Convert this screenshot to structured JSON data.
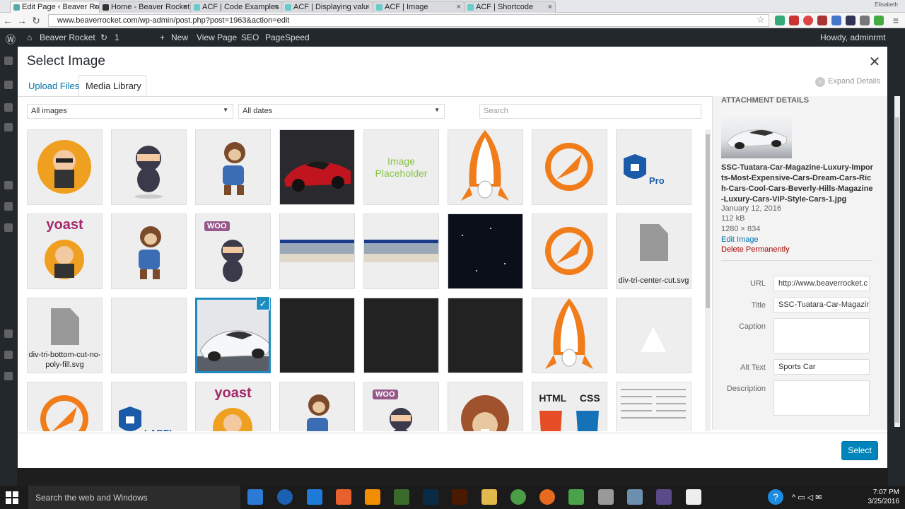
{
  "browser": {
    "tabs": [
      {
        "label": "Edit Page ‹ Beaver Ro",
        "active": true
      },
      {
        "label": "Home - Beaver Rocket"
      },
      {
        "label": "ACF | Code Examples"
      },
      {
        "label": "ACF | Displaying valu"
      },
      {
        "label": "ACF | Image"
      },
      {
        "label": "ACF | Shortcode"
      }
    ],
    "url": "www.beaverrocket.com/wp-admin/post.php?post=1963&action=edit",
    "user_badge": "Elisabeth"
  },
  "adminbar": {
    "site": "Beaver Rocket",
    "updates": "1",
    "new": "New",
    "view_page": "View Page",
    "seo": "SEO",
    "pagespeed": "PageSpeed",
    "howdy": "Howdy, adminrmt"
  },
  "modal": {
    "title": "Select Image",
    "tab_upload": "Upload Files",
    "tab_library": "Media Library",
    "expand_details": "Expand Details",
    "filter_type": "All images",
    "filter_date": "All dates",
    "search_placeholder": "Search",
    "select_button": "Select"
  },
  "grid": {
    "items": [
      {
        "kind": "avatar"
      },
      {
        "kind": "ninja"
      },
      {
        "kind": "monkey"
      },
      {
        "kind": "redcar"
      },
      {
        "kind": "placeholder",
        "label": "Image Placeholder"
      },
      {
        "kind": "rocket"
      },
      {
        "kind": "rocketlogo"
      },
      {
        "kind": "shield",
        "label": "Pro"
      },
      {
        "kind": "yoast",
        "label": "yoast"
      },
      {
        "kind": "monkey"
      },
      {
        "kind": "woo",
        "label": "WOO"
      },
      {
        "kind": "banner"
      },
      {
        "kind": "banner"
      },
      {
        "kind": "space"
      },
      {
        "kind": "rocketlogo"
      },
      {
        "kind": "file",
        "label": "div-tri-center-cut.svg"
      },
      {
        "kind": "file",
        "label": "div-tri-bottom-cut-no-poly-fill.svg"
      },
      {
        "kind": "blank"
      },
      {
        "kind": "whitecar",
        "selected": true
      },
      {
        "kind": "dark"
      },
      {
        "kind": "dark"
      },
      {
        "kind": "dark"
      },
      {
        "kind": "rocket"
      },
      {
        "kind": "triangle"
      },
      {
        "kind": "rocketlogo"
      },
      {
        "kind": "shield"
      },
      {
        "kind": "yoast",
        "label": "yoast"
      },
      {
        "kind": "monkey"
      },
      {
        "kind": "woo",
        "label": "WOO"
      },
      {
        "kind": "beaver"
      },
      {
        "kind": "htmlcss",
        "label": "HTML CSS"
      },
      {
        "kind": "newspaper"
      }
    ]
  },
  "details": {
    "heading": "Attachment Details",
    "filename": "SSC-Tuatara-Car-Magazine-Luxury-Imports-Most-Expensive-Cars-Dream-Cars-Rich-Cars-Cool-Cars-Beverly-Hills-Magazine-Luxury-Cars-VIP-Style-Cars-1.jpg",
    "date": "January 12, 2016",
    "size": "112 kB",
    "dimensions": "1280 × 834",
    "edit_image": "Edit Image",
    "delete": "Delete Permanently",
    "url_label": "URL",
    "url_value": "http://www.beaverrocket.c",
    "title_label": "Title",
    "title_value": "SSC-Tuatara-Car-Magazine",
    "caption_label": "Caption",
    "alt_label": "Alt Text",
    "alt_value": "Sports Car",
    "description_label": "Description"
  },
  "taskbar": {
    "search": "Search the web and Windows",
    "time": "7:07 PM",
    "date": "3/25/2016"
  }
}
